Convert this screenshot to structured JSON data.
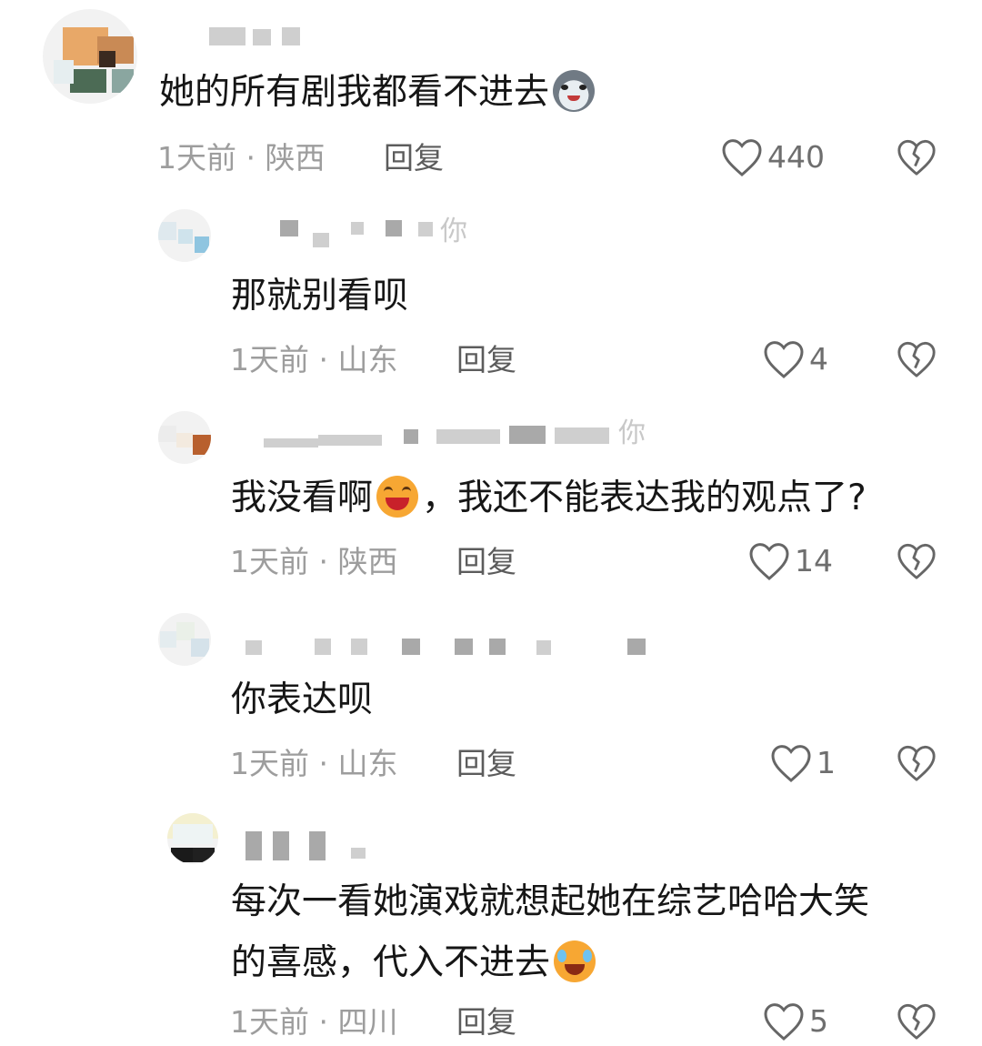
{
  "comments": [
    {
      "text": "她的所有剧我都看不进去",
      "emoji": "wolf-face-emoji",
      "meta": "1天前 · 陕西",
      "reply_label": "回复",
      "likes": "440"
    },
    {
      "name_tail": "你",
      "text": "那就别看呗",
      "meta": "1天前 · 山东",
      "reply_label": "回复",
      "likes": "4"
    },
    {
      "name_tail": "你",
      "text_before": "我没看啊",
      "emoji": "grinning-squint-emoji",
      "text_after": "，我还不能表达我的观点了?",
      "meta": "1天前 · 陕西",
      "reply_label": "回复",
      "likes": "14"
    },
    {
      "text": "你表达呗",
      "meta": "1天前 · 山东",
      "reply_label": "回复",
      "likes": "1"
    },
    {
      "text_line1": "每次一看她演戏就想起她在综艺哈哈大笑",
      "text_line2": "的喜感，代入不进去",
      "emoji": "crying-laughing-emoji",
      "meta": "1天前 · 四川",
      "reply_label": "回复",
      "likes": "5"
    }
  ],
  "colors": {
    "text": "#161616",
    "meta": "#9d9d9d",
    "icon": "#666666"
  }
}
